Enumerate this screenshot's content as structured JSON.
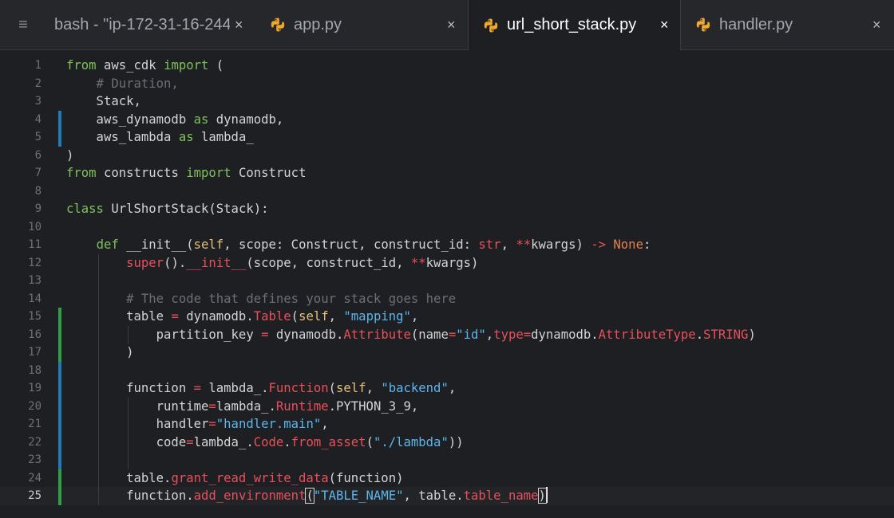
{
  "tabs": [
    {
      "name": "tab-bash",
      "label": "bash - \"ip-172-31-16-244.",
      "close": "×",
      "icon": "",
      "active": false
    },
    {
      "name": "tab-app-py",
      "label": "app.py",
      "close": "×",
      "icon": "python-icon",
      "active": false
    },
    {
      "name": "tab-url-short-stack-py",
      "label": "url_short_stack.py",
      "close": "×",
      "icon": "python-icon",
      "active": true
    },
    {
      "name": "tab-handler-py",
      "label": "handler.py",
      "close": "×",
      "icon": "python-icon",
      "active": false
    }
  ],
  "menu_icon": "≡",
  "colors": {
    "added": "#2ea043",
    "modified": "#1f7ab8",
    "keyword": "#7fc25a",
    "string": "#5cb6ec",
    "call": "#e8505b",
    "comment": "#6d6f75"
  },
  "editor": {
    "current_line": 25,
    "lines": [
      {
        "n": "1",
        "gutter": "",
        "tokens": [
          {
            "t": "from",
            "c": "keyword"
          },
          {
            "t": " aws_cdk ",
            "c": "default"
          },
          {
            "t": "import",
            "c": "keyword"
          },
          {
            "t": " (",
            "c": "default"
          }
        ]
      },
      {
        "n": "2",
        "gutter": "",
        "tokens": [
          {
            "t": "    # Duration,",
            "c": "comment"
          }
        ]
      },
      {
        "n": "3",
        "gutter": "",
        "tokens": [
          {
            "t": "    Stack,",
            "c": "default"
          }
        ]
      },
      {
        "n": "4",
        "gutter": "modified",
        "tokens": [
          {
            "t": "    aws_dynamodb ",
            "c": "default"
          },
          {
            "t": "as",
            "c": "keyword"
          },
          {
            "t": " dynamodb,",
            "c": "default"
          }
        ]
      },
      {
        "n": "5",
        "gutter": "modified",
        "tokens": [
          {
            "t": "    aws_lambda ",
            "c": "default"
          },
          {
            "t": "as",
            "c": "keyword"
          },
          {
            "t": " lambda_",
            "c": "default"
          }
        ]
      },
      {
        "n": "6",
        "gutter": "",
        "tokens": [
          {
            "t": ")",
            "c": "default"
          }
        ]
      },
      {
        "n": "7",
        "gutter": "",
        "tokens": [
          {
            "t": "from",
            "c": "keyword"
          },
          {
            "t": " constructs ",
            "c": "default"
          },
          {
            "t": "import",
            "c": "keyword"
          },
          {
            "t": " Construct",
            "c": "default"
          }
        ]
      },
      {
        "n": "8",
        "gutter": "",
        "tokens": []
      },
      {
        "n": "9",
        "gutter": "",
        "tokens": [
          {
            "t": "class",
            "c": "keyword"
          },
          {
            "t": " UrlShortStack(Stack):",
            "c": "default"
          }
        ]
      },
      {
        "n": "10",
        "gutter": "",
        "tokens": []
      },
      {
        "n": "11",
        "gutter": "",
        "tokens": [
          {
            "t": "    ",
            "c": "default"
          },
          {
            "t": "def",
            "c": "keyword"
          },
          {
            "t": " __init__(",
            "c": "default"
          },
          {
            "t": "self",
            "c": "self"
          },
          {
            "t": ", scope: Construct, construct_id: ",
            "c": "default"
          },
          {
            "t": "str",
            "c": "call"
          },
          {
            "t": ", ",
            "c": "default"
          },
          {
            "t": "**",
            "c": "punct"
          },
          {
            "t": "kwargs) ",
            "c": "default"
          },
          {
            "t": "->",
            "c": "punct"
          },
          {
            "t": " ",
            "c": "default"
          },
          {
            "t": "None",
            "c": "none"
          },
          {
            "t": ":",
            "c": "default"
          }
        ]
      },
      {
        "n": "12",
        "gutter": "",
        "tokens": [
          {
            "t": "        ",
            "c": "default"
          },
          {
            "t": "super",
            "c": "call"
          },
          {
            "t": "().",
            "c": "default"
          },
          {
            "t": "__init__",
            "c": "call"
          },
          {
            "t": "(scope, construct_id, ",
            "c": "default"
          },
          {
            "t": "**",
            "c": "punct"
          },
          {
            "t": "kwargs)",
            "c": "default"
          }
        ]
      },
      {
        "n": "13",
        "gutter": "",
        "tokens": []
      },
      {
        "n": "14",
        "gutter": "",
        "tokens": [
          {
            "t": "        # The code that defines your stack goes here",
            "c": "comment"
          }
        ]
      },
      {
        "n": "15",
        "gutter": "added",
        "tokens": [
          {
            "t": "        table ",
            "c": "default"
          },
          {
            "t": "=",
            "c": "punct"
          },
          {
            "t": " dynamodb.",
            "c": "default"
          },
          {
            "t": "Table",
            "c": "call"
          },
          {
            "t": "(",
            "c": "default"
          },
          {
            "t": "self",
            "c": "self"
          },
          {
            "t": ", ",
            "c": "default"
          },
          {
            "t": "\"mapping\"",
            "c": "string"
          },
          {
            "t": ",",
            "c": "default"
          }
        ]
      },
      {
        "n": "16",
        "gutter": "added",
        "tokens": [
          {
            "t": "            partition_key ",
            "c": "default"
          },
          {
            "t": "=",
            "c": "punct"
          },
          {
            "t": " dynamodb.",
            "c": "default"
          },
          {
            "t": "Attribute",
            "c": "call"
          },
          {
            "t": "(name",
            "c": "default"
          },
          {
            "t": "=",
            "c": "punct"
          },
          {
            "t": "\"id\"",
            "c": "string"
          },
          {
            "t": ",",
            "c": "default"
          },
          {
            "t": "type",
            "c": "call"
          },
          {
            "t": "=",
            "c": "punct"
          },
          {
            "t": "dynamodb.",
            "c": "default"
          },
          {
            "t": "AttributeType",
            "c": "call"
          },
          {
            "t": ".",
            "c": "default"
          },
          {
            "t": "STRING",
            "c": "call"
          },
          {
            "t": ")",
            "c": "default"
          }
        ]
      },
      {
        "n": "17",
        "gutter": "added",
        "tokens": [
          {
            "t": "        )",
            "c": "default"
          }
        ]
      },
      {
        "n": "18",
        "gutter": "modified",
        "tokens": []
      },
      {
        "n": "19",
        "gutter": "modified",
        "tokens": [
          {
            "t": "        function ",
            "c": "default"
          },
          {
            "t": "=",
            "c": "punct"
          },
          {
            "t": " lambda_.",
            "c": "default"
          },
          {
            "t": "Function",
            "c": "call"
          },
          {
            "t": "(",
            "c": "default"
          },
          {
            "t": "self",
            "c": "self"
          },
          {
            "t": ", ",
            "c": "default"
          },
          {
            "t": "\"backend\"",
            "c": "string"
          },
          {
            "t": ",",
            "c": "default"
          }
        ]
      },
      {
        "n": "20",
        "gutter": "modified",
        "tokens": [
          {
            "t": "            runtime",
            "c": "default"
          },
          {
            "t": "=",
            "c": "punct"
          },
          {
            "t": "lambda_.",
            "c": "default"
          },
          {
            "t": "Runtime",
            "c": "call"
          },
          {
            "t": ".PYTHON_3_9,",
            "c": "default"
          }
        ]
      },
      {
        "n": "21",
        "gutter": "modified",
        "tokens": [
          {
            "t": "            handler",
            "c": "default"
          },
          {
            "t": "=",
            "c": "punct"
          },
          {
            "t": "\"handler.main\"",
            "c": "string"
          },
          {
            "t": ",",
            "c": "default"
          }
        ]
      },
      {
        "n": "22",
        "gutter": "modified",
        "tokens": [
          {
            "t": "            code",
            "c": "default"
          },
          {
            "t": "=",
            "c": "punct"
          },
          {
            "t": "lambda_.",
            "c": "default"
          },
          {
            "t": "Code",
            "c": "call"
          },
          {
            "t": ".",
            "c": "default"
          },
          {
            "t": "from_asset",
            "c": "call"
          },
          {
            "t": "(",
            "c": "default"
          },
          {
            "t": "\"./lambda\"",
            "c": "string"
          },
          {
            "t": "))",
            "c": "default"
          }
        ]
      },
      {
        "n": "23",
        "gutter": "modified",
        "tokens": []
      },
      {
        "n": "24",
        "gutter": "added",
        "tokens": [
          {
            "t": "        table.",
            "c": "default"
          },
          {
            "t": "grant_read_write_data",
            "c": "call"
          },
          {
            "t": "(function)",
            "c": "default"
          }
        ]
      },
      {
        "n": "25",
        "gutter": "added",
        "tokens": [
          {
            "t": "        function.",
            "c": "default"
          },
          {
            "t": "add_environment",
            "c": "call"
          },
          {
            "t": "(",
            "c": "default",
            "box": true
          },
          {
            "t": "\"TABLE_NAME\"",
            "c": "string"
          },
          {
            "t": ", table.",
            "c": "default"
          },
          {
            "t": "table_name",
            "c": "call"
          },
          {
            "t": ")",
            "c": "default",
            "box": true
          }
        ]
      }
    ]
  }
}
